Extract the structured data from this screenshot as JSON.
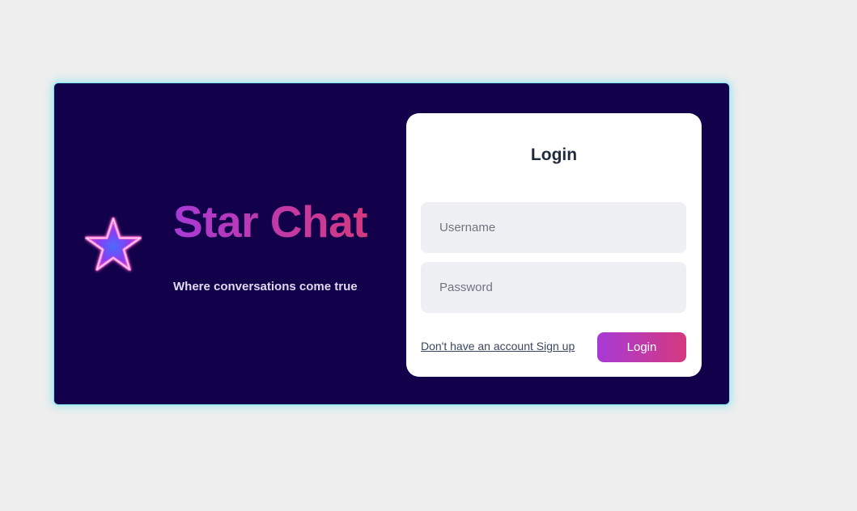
{
  "brand": {
    "name": "Star Chat",
    "tagline": "Where conversations come true",
    "logo_icon": "star-icon",
    "gradient_start": "#a83ad6",
    "gradient_end": "#d4397f"
  },
  "hero": {
    "background": "#13004a",
    "glow": "#7fe3f0"
  },
  "login": {
    "heading": "Login",
    "username_placeholder": "Username",
    "username_value": "",
    "password_placeholder": "Password",
    "password_value": "",
    "signup_link": "Don't have an account Sign up",
    "submit_label": "Login"
  }
}
